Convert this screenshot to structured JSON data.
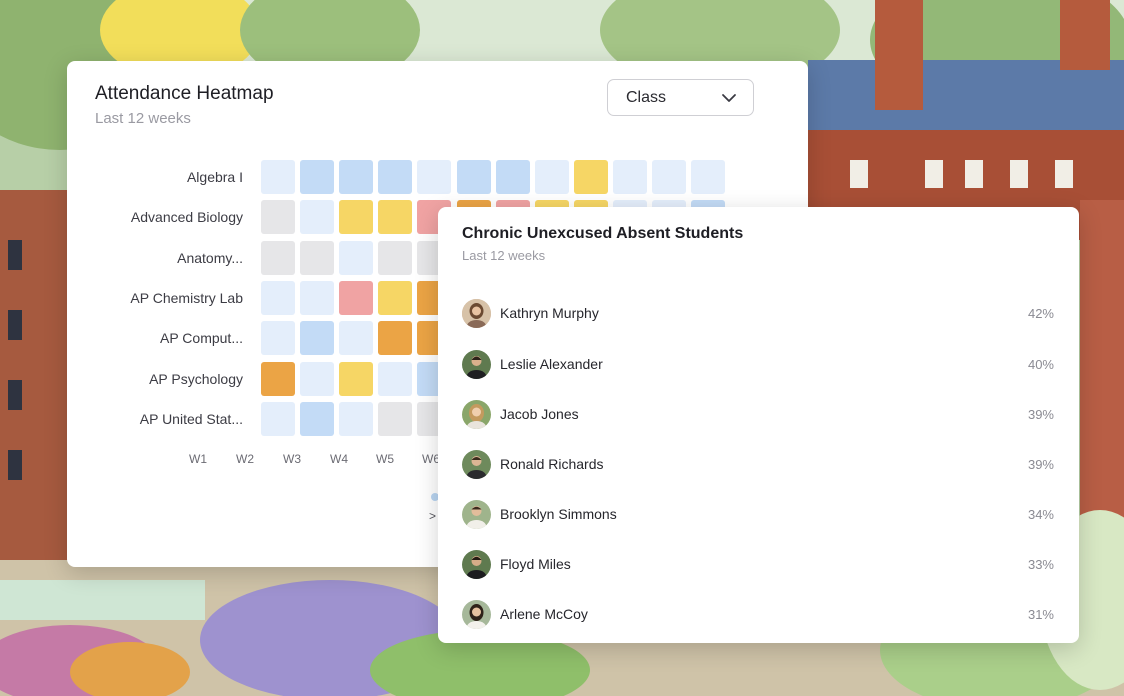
{
  "heatmap": {
    "title": "Attendance Heatmap",
    "subtitle": "Last 12 weeks",
    "group_select": {
      "value": "Class"
    },
    "rows": [
      "Algebra I",
      "Advanced Biology",
      "Anatomy...",
      "AP Chemistry Lab",
      "AP Comput...",
      "AP Psychology",
      "AP United Stat..."
    ],
    "columns": [
      "W1",
      "W2",
      "W3",
      "W4",
      "W5",
      "W6"
    ],
    "legend_fragment": ">",
    "chart_data": {
      "type": "heatmap",
      "title": "Attendance Heatmap",
      "subtitle": "Last 12 weeks",
      "y_categories": [
        "Algebra I",
        "Advanced Biology",
        "Anatomy...",
        "AP Chemistry Lab",
        "AP Comput...",
        "AP Psychology",
        "AP United Stat..."
      ],
      "x_categories": [
        "W1",
        "W2",
        "W3",
        "W4",
        "W5",
        "W6"
      ],
      "color_levels": {
        "none": "#e6e6e8",
        "very_low": "#e4eefb",
        "low": "#c3dbf6",
        "medium": "#f6d665",
        "high": "#eba445",
        "very_high": "#f0a3a3"
      },
      "visible_cells": [
        [
          "very_low",
          "low",
          "low",
          "low",
          "very_low",
          "low",
          "low",
          "very_low",
          "medium",
          "very_low",
          "very_low",
          "very_low"
        ],
        [
          "none",
          "very_low",
          "medium",
          "medium",
          "very_high",
          "high",
          "very_high",
          "medium",
          "medium",
          "very_low",
          "very_low",
          "low"
        ],
        [
          "none",
          "none",
          "very_low",
          "none",
          "none"
        ],
        [
          "very_low",
          "very_low",
          "very_high",
          "medium",
          "high"
        ],
        [
          "very_low",
          "low",
          "very_low",
          "high",
          "high"
        ],
        [
          "high",
          "very_low",
          "medium",
          "very_low",
          "low"
        ],
        [
          "very_low",
          "low",
          "very_low",
          "none",
          "none"
        ]
      ]
    }
  },
  "absent": {
    "title": "Chronic Unexcused Absent Students",
    "subtitle": "Last 12 weeks",
    "students": [
      {
        "name": "Kathryn Murphy",
        "pct": "42%",
        "avatar": "woman-avatar-icon"
      },
      {
        "name": "Leslie Alexander",
        "pct": "40%",
        "avatar": "man-avatar-icon"
      },
      {
        "name": "Jacob Jones",
        "pct": "39%",
        "avatar": "woman-avatar-icon"
      },
      {
        "name": "Ronald Richards",
        "pct": "39%",
        "avatar": "man-avatar-icon"
      },
      {
        "name": "Brooklyn Simmons",
        "pct": "34%",
        "avatar": "man-avatar-icon"
      },
      {
        "name": "Floyd Miles",
        "pct": "33%",
        "avatar": "man-avatar-icon"
      },
      {
        "name": "Arlene McCoy",
        "pct": "31%",
        "avatar": "woman-avatar-icon"
      }
    ]
  }
}
